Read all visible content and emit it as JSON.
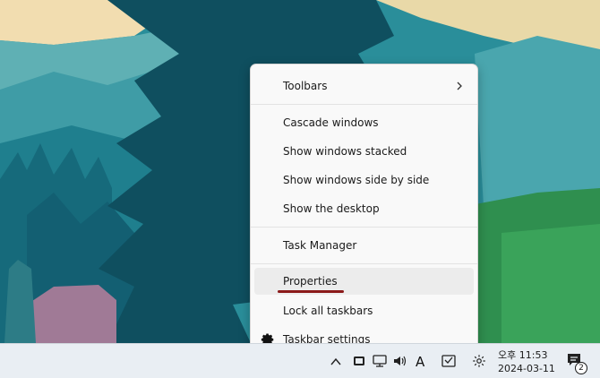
{
  "desktop": {
    "wallpaper": "forest-mountains"
  },
  "context_menu": {
    "items": [
      {
        "label": "Toolbars",
        "has_submenu": true
      },
      {
        "label": "Cascade windows"
      },
      {
        "label": "Show windows stacked"
      },
      {
        "label": "Show windows side by side"
      },
      {
        "label": "Show the desktop"
      },
      {
        "label": "Task Manager"
      },
      {
        "label": "Properties",
        "highlighted": true
      },
      {
        "label": "Lock all taskbars"
      },
      {
        "label": "Taskbar settings",
        "icon": "gear-icon"
      }
    ]
  },
  "taskbar": {
    "tray": {
      "icons": [
        "chevron-up-icon",
        "tablet-icon",
        "network-icon",
        "volume-icon",
        "ime-icon",
        "touch-keyboard-icon",
        "settings-icon"
      ],
      "ime_label": "A",
      "time": "오후 11:53",
      "date": "2024-03-11",
      "notifications_count": "2"
    }
  },
  "colors": {
    "menu_bg": "#f9f9f9",
    "hover_bg": "#ececec",
    "annotation_red": "#8b1a1a",
    "taskbar_bg": "#e9eef3"
  }
}
